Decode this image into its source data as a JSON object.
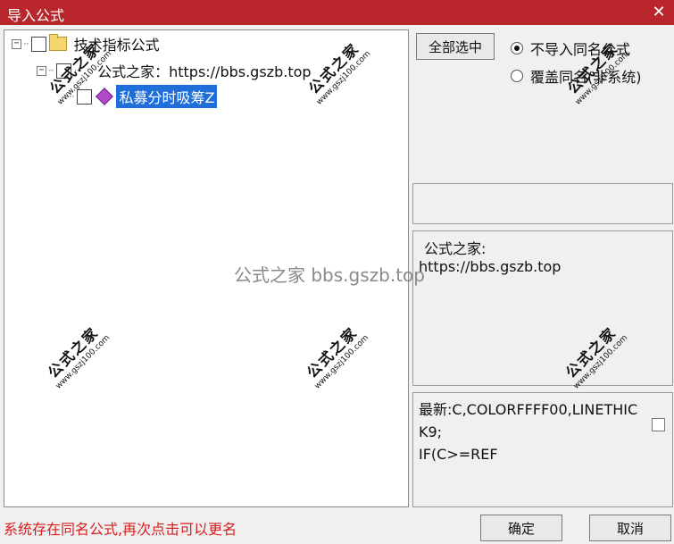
{
  "window": {
    "title": "导入公式",
    "close_glyph": "✕"
  },
  "tree": {
    "root": {
      "label": "技术指标公式",
      "expander": "⊟"
    },
    "group": {
      "label": "公式之家：https://bbs.gszb.top",
      "expander": "⊟"
    },
    "item": {
      "label": "私募分时吸筹Z",
      "selected": true
    }
  },
  "controls": {
    "select_all_label": "全部选中",
    "radio_skip_label": "不导入同名公式",
    "radio_overwrite_label": "覆盖同名(非系统)",
    "radio_selected": "skip"
  },
  "description": {
    "line1": "公式之家:",
    "line2": "https://bbs.gszb.top"
  },
  "code": {
    "text": "最新:C,COLORFFFF00,LINETHICK9;\nIF(C>=REF"
  },
  "status_text": "系统存在同名公式,再次点击可以更名",
  "buttons": {
    "ok_label": "确定",
    "cancel_label": "取消"
  },
  "watermarks": {
    "title": "公式之家",
    "url": "www.gszj100.com"
  },
  "center_watermark": "公式之家 bbs.gszb.top",
  "colors": {
    "titlebar": "#b8262b",
    "selection": "#1e6fd9",
    "status": "#d81e1e"
  }
}
